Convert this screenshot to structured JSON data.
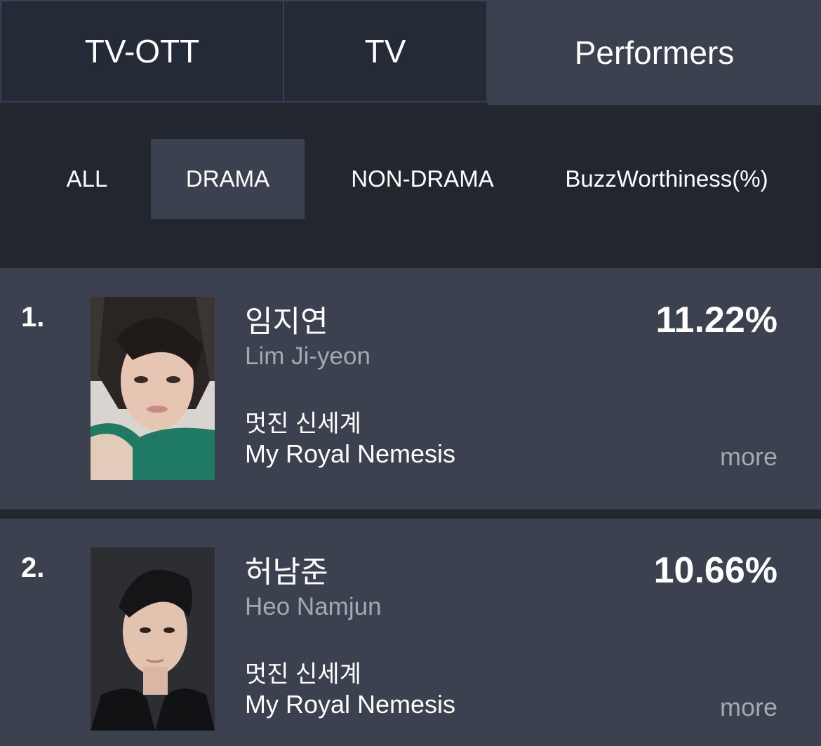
{
  "top_tabs": [
    {
      "label": "TV-OTT",
      "active": false
    },
    {
      "label": "TV",
      "active": false
    },
    {
      "label": "Performers",
      "active": true
    }
  ],
  "sub_tabs": [
    {
      "label": "ALL",
      "active": false
    },
    {
      "label": "DRAMA",
      "active": true
    },
    {
      "label": "NON-DRAMA",
      "active": false
    },
    {
      "label": "BuzzWorthiness(%)",
      "active": false
    }
  ],
  "rankings": [
    {
      "rank": "1.",
      "name_ko": "임지연",
      "name_en": "Lim Ji-yeon",
      "show_ko": "멋진 신세계",
      "show_en": "My Royal Nemesis",
      "percent": "11.22%",
      "more_label": "more",
      "photo": "performer-photo"
    },
    {
      "rank": "2.",
      "name_ko": "허남준",
      "name_en": "Heo Namjun",
      "show_ko": "멋진 신세계",
      "show_en": "My Royal Nemesis",
      "percent": "10.66%",
      "more_label": "more",
      "photo": "performer-photo"
    }
  ],
  "colors": {
    "background": "#22262f",
    "active_tab": "#3b414e",
    "card": "#3b414e",
    "muted_text": "#a4a8b1"
  }
}
